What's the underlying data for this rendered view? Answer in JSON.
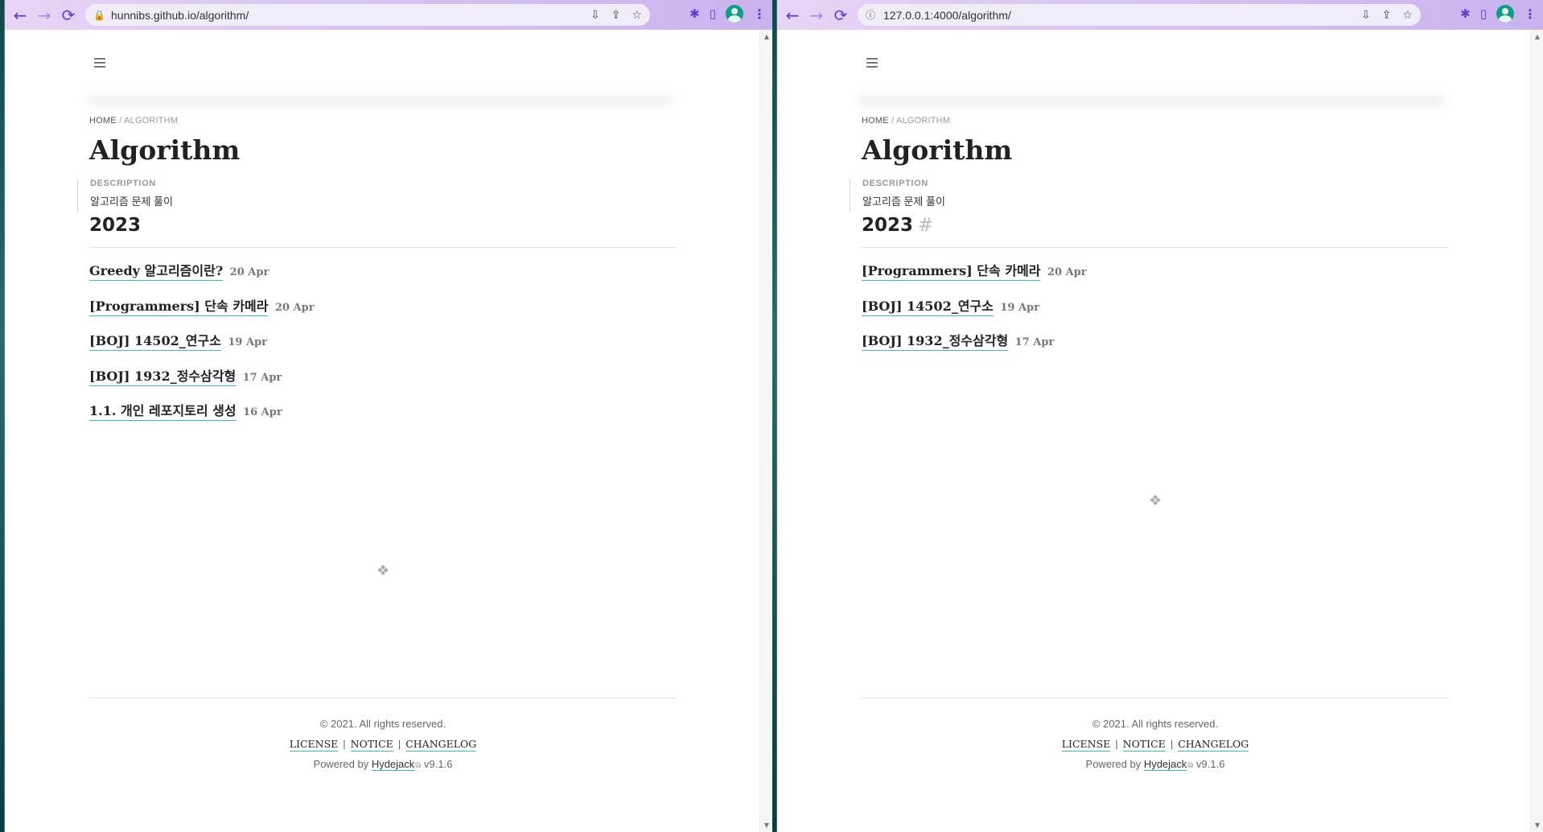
{
  "windows": [
    {
      "url": "hunnibs.github.io/algorithm/",
      "site_icon": "lock-icon",
      "breadcrumb": {
        "home": "HOME",
        "sep": "/",
        "current": "ALGORITHM"
      },
      "title": "Algorithm",
      "description_label": "DESCRIPTION",
      "description": "알고리즘 문제 풀이",
      "year": "2023",
      "year_anchor": "",
      "posts": [
        {
          "title": "Greedy 알고리즘이란?",
          "date": "20 Apr"
        },
        {
          "title": "[Programmers] 단속 카메라",
          "date": "20 Apr"
        },
        {
          "title": "[BOJ] 14502_연구소",
          "date": "19 Apr"
        },
        {
          "title": "[BOJ] 1932_정수삼각형",
          "date": "17 Apr"
        },
        {
          "title": "1.1. 개인 레포지토리 생성",
          "date": "16 Apr"
        }
      ],
      "footer": {
        "copyright": "© 2021. All rights reserved.",
        "links": [
          "LICENSE",
          "NOTICE",
          "CHANGELOG"
        ],
        "separator": "|",
        "powered_prefix": "Powered by",
        "powered_link": "Hydejack",
        "version": "v9.1.6"
      }
    },
    {
      "url": "127.0.0.1:4000/algorithm/",
      "site_icon": "info-icon",
      "breadcrumb": {
        "home": "HOME",
        "sep": "/",
        "current": "ALGORITHM"
      },
      "title": "Algorithm",
      "description_label": "DESCRIPTION",
      "description": "알고리즘 문제 풀이",
      "year": "2023",
      "year_anchor": "#",
      "posts": [
        {
          "title": "[Programmers] 단속 카메라",
          "date": "20 Apr"
        },
        {
          "title": "[BOJ] 14502_연구소",
          "date": "19 Apr"
        },
        {
          "title": "[BOJ] 1932_정수삼각형",
          "date": "17 Apr"
        }
      ],
      "footer": {
        "copyright": "© 2021. All rights reserved.",
        "links": [
          "LICENSE",
          "NOTICE",
          "CHANGELOG"
        ],
        "separator": "|",
        "powered_prefix": "Powered by",
        "powered_link": "Hydejack",
        "version": "v9.1.6"
      }
    }
  ],
  "theme": {
    "accent": "#4fb1ba",
    "toolbar": "#d8c4f1",
    "icon": "#5b3fd1"
  },
  "glyphs": {
    "back": "←",
    "forward": "→",
    "reload": "⟳",
    "ornament": "❖",
    "lock": "🔒",
    "info": "ⓘ"
  }
}
